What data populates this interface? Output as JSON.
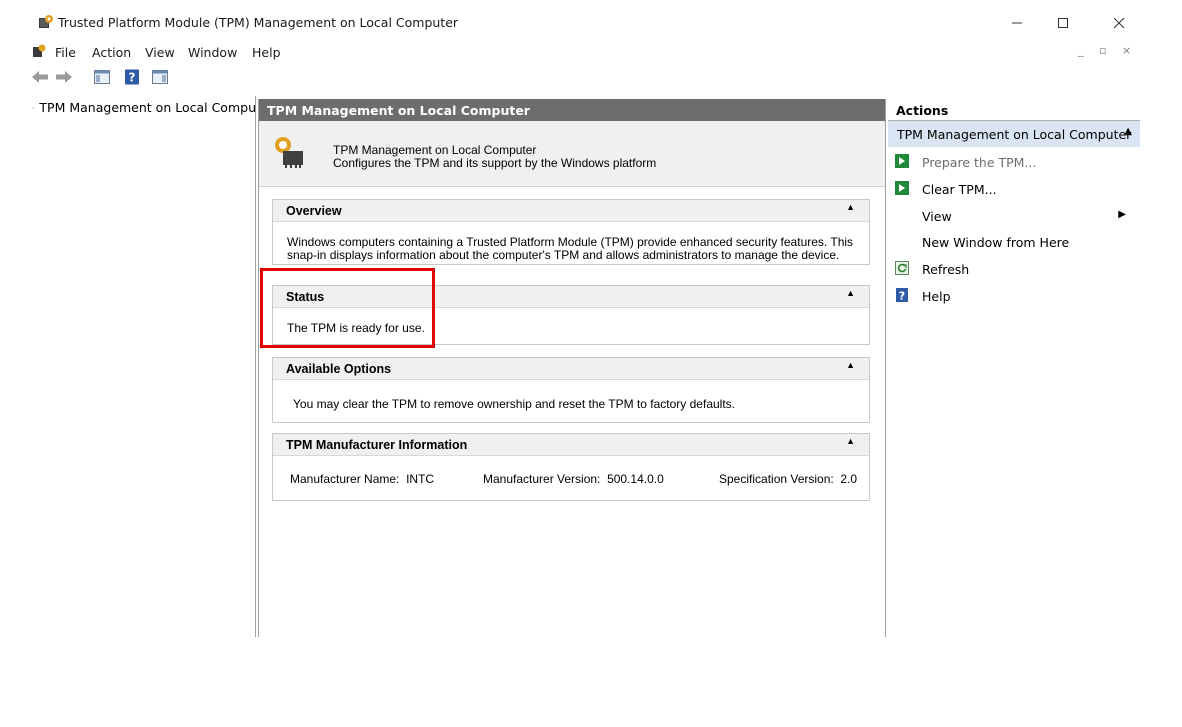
{
  "window": {
    "title": "Trusted Platform Module (TPM) Management on Local Computer",
    "controls": {
      "minimize": "—",
      "maximize": "☐",
      "close": "✕"
    }
  },
  "menu": {
    "items": [
      "File",
      "Action",
      "View",
      "Window",
      "Help"
    ],
    "mdi_controls": "_ ▫ ×"
  },
  "toolbar": {
    "icons": [
      "back-arrow-icon",
      "forward-arrow-icon",
      "show-hide-console-tree-icon",
      "help-icon",
      "show-hide-action-pane-icon"
    ]
  },
  "tree": {
    "root_label": "TPM Management on Local Compu"
  },
  "center": {
    "header": "TPM Management on Local Computer",
    "snapin_title": "TPM Management on Local Computer",
    "snapin_desc": "Configures the TPM and its support by the Windows platform",
    "overview": {
      "title": "Overview",
      "line1": "Windows computers containing a Trusted Platform Module (TPM) provide enhanced security features. This",
      "line2": "snap-in displays information about the computer's TPM and allows administrators to manage the device."
    },
    "status": {
      "title": "Status",
      "text": "The TPM is ready for use."
    },
    "options": {
      "title": "Available Options",
      "text": "You may clear the TPM to remove ownership and reset the TPM to factory defaults."
    },
    "manufacturer": {
      "title": "TPM Manufacturer Information",
      "name_label": "Manufacturer Name:",
      "name_value": "INTC",
      "version_label": "Manufacturer Version:",
      "version_value": "500.14.0.0",
      "spec_label": "Specification Version:",
      "spec_value": "2.0"
    },
    "collapse_glyph": "▲"
  },
  "actions": {
    "header": "Actions",
    "section": "TPM Management on Local Computer",
    "items": [
      {
        "label": "Prepare the TPM...",
        "icon": "green-arrow-icon",
        "enabled": false
      },
      {
        "label": "Clear TPM...",
        "icon": "green-arrow-icon",
        "enabled": true
      },
      {
        "label": "View",
        "icon": "",
        "enabled": true,
        "submenu": "▶"
      },
      {
        "label": "New Window from Here",
        "icon": "",
        "enabled": true
      },
      {
        "label": "Refresh",
        "icon": "refresh-icon",
        "enabled": true
      },
      {
        "label": "Help",
        "icon": "help-icon",
        "enabled": true
      }
    ]
  },
  "colors": {
    "highlight": "#e00000",
    "center_header": "#6d6d6d",
    "actions_section": "#d9e5f3"
  }
}
